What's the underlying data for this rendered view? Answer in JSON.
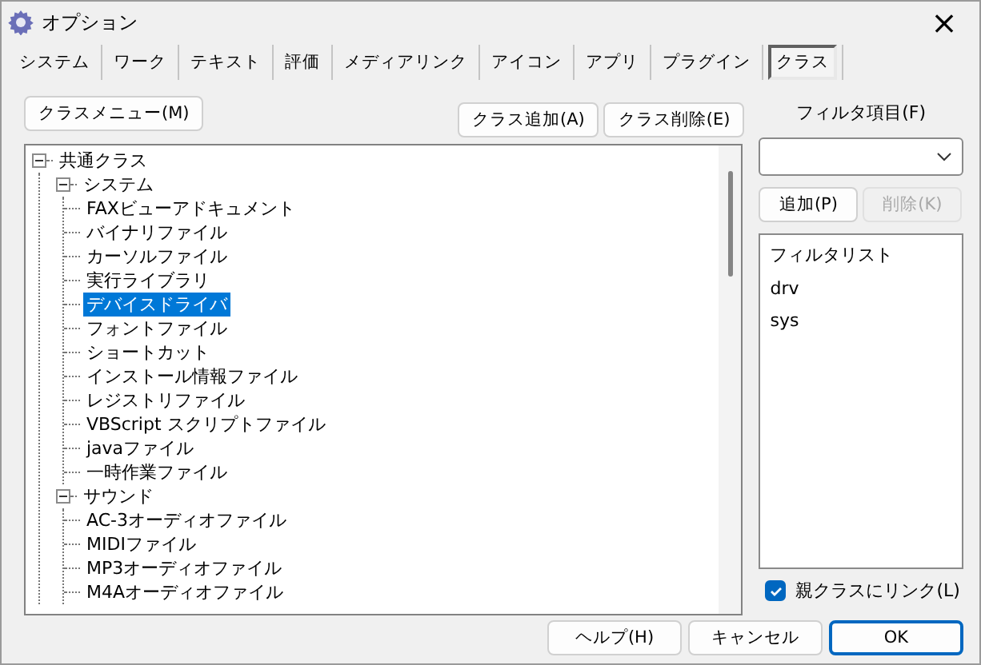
{
  "window": {
    "title": "オプション",
    "close": "×"
  },
  "tabs": [
    {
      "label": "システム",
      "selected": false
    },
    {
      "label": "ワーク",
      "selected": false
    },
    {
      "label": "テキスト",
      "selected": false
    },
    {
      "label": "評価",
      "selected": false
    },
    {
      "label": "メディアリンク",
      "selected": false
    },
    {
      "label": "アイコン",
      "selected": false
    },
    {
      "label": "アプリ",
      "selected": false
    },
    {
      "label": "プラグイン",
      "selected": false
    },
    {
      "label": "クラス",
      "selected": true
    }
  ],
  "class_menu_button": "クラスメニュー(M)",
  "class_buttons": [
    "クラス追加(A)",
    "クラス削除(E)"
  ],
  "tree": [
    {
      "label": "共通クラス",
      "expanded": true,
      "selected": false,
      "children": [
        {
          "label": "システム",
          "expanded": true,
          "selected": false,
          "children": [
            {
              "label": "FAXビューアドキュメント",
              "selected": false
            },
            {
              "label": "バイナリファイル",
              "selected": false
            },
            {
              "label": "カーソルファイル",
              "selected": false
            },
            {
              "label": "実行ライブラリ",
              "selected": false
            },
            {
              "label": "デバイスドライバ",
              "selected": true
            },
            {
              "label": "フォントファイル",
              "selected": false
            },
            {
              "label": "ショートカット",
              "selected": false
            },
            {
              "label": "インストール情報ファイル",
              "selected": false
            },
            {
              "label": "レジストリファイル",
              "selected": false
            },
            {
              "label": "VBScript スクリプトファイル",
              "selected": false
            },
            {
              "label": "javaファイル",
              "selected": false
            },
            {
              "label": "一時作業ファイル",
              "selected": false
            }
          ]
        },
        {
          "label": "サウンド",
          "expanded": true,
          "selected": false,
          "children": [
            {
              "label": "AC-3オーディオファイル",
              "selected": false
            },
            {
              "label": "MIDIファイル",
              "selected": false
            },
            {
              "label": "MP3オーディオファイル",
              "selected": false
            },
            {
              "label": "M4Aオーディオファイル",
              "selected": false
            }
          ]
        }
      ]
    }
  ],
  "filter": {
    "label": "フィルタ項目(F)",
    "add_button": {
      "label": "追加(P)",
      "disabled": false
    },
    "delete_button": {
      "label": "削除(K)",
      "disabled": true
    },
    "list_header": "フィルタリスト",
    "items": [
      "drv",
      "sys"
    ]
  },
  "link_parent": {
    "label": "親クラスにリンク(L)",
    "checked": true
  },
  "buttons": [
    {
      "label": "ヘルプ(H)",
      "default": false
    },
    {
      "label": "キャンセル",
      "default": false
    },
    {
      "label": "OK",
      "default": true
    }
  ]
}
